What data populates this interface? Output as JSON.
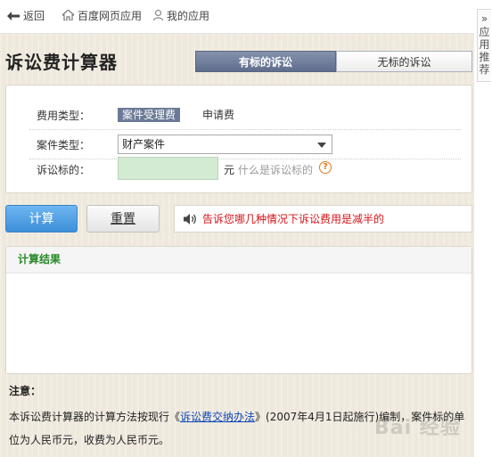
{
  "nav": {
    "back": "返回",
    "home": "百度网页应用",
    "my_apps": "我的应用"
  },
  "side_tab": {
    "chars": [
      "应",
      "用",
      "推",
      "荐"
    ]
  },
  "title": "诉讼费计算器",
  "tabs": [
    {
      "label": "有标的诉讼",
      "active": true
    },
    {
      "label": "无标的诉讼",
      "active": false
    }
  ],
  "form": {
    "fee_type_label": "费用类型：",
    "fee_options": [
      "案件受理费",
      "申请费"
    ],
    "case_type_label": "案件类型：",
    "case_type_value": "财产案件",
    "amount_label": "诉讼标的：",
    "amount_value": "",
    "unit": "元",
    "what_is_link": "什么是诉讼标的",
    "help_icon": "?"
  },
  "buttons": {
    "calculate": "计算",
    "reset": "重置"
  },
  "notice": "告诉您哪几种情况下诉讼费用是减半的",
  "result": {
    "title": "计算结果"
  },
  "note": {
    "title": "注意：",
    "prefix": "本诉讼费计算器的计算方法按现行《",
    "link": "诉讼费交纳办法",
    "suffix": "》(2007年4月1日起施行)编制，案件标的单位为人民币元，收费为人民币元。"
  },
  "watermark": "Bai 经验",
  "colors": {
    "accent_blue": "#3c8fd9",
    "tab_active": "#5f6d8d",
    "notice_red": "#d4141a",
    "result_green": "#2a8a2a",
    "amount_bg": "#d3ead3"
  }
}
